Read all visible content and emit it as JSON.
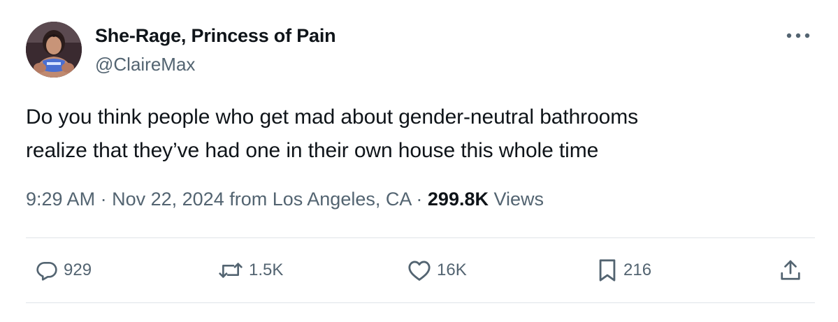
{
  "author": {
    "display_name": "She-Rage, Princess of Pain",
    "handle": "@ClaireMax",
    "avatar_icon": "profile-photo"
  },
  "tweet": {
    "text": "Do you think people who get mad about gender-neutral bathrooms\nrealize that they’ve had one in their own house this whole time",
    "time": "9:29 AM",
    "separator": "·",
    "date": "Nov 22, 2024",
    "location": "from Los Angeles, CA",
    "views_count": "299.8K",
    "views_label": "Views"
  },
  "actions": {
    "reply": {
      "icon": "reply-icon",
      "count": "929"
    },
    "repost": {
      "icon": "repost-icon",
      "count": "1.5K"
    },
    "like": {
      "icon": "heart-icon",
      "count": "16K"
    },
    "bookmark": {
      "icon": "bookmark-icon",
      "count": "216"
    },
    "share": {
      "icon": "share-icon"
    }
  },
  "menu": {
    "icon": "more-icon"
  },
  "colors": {
    "text_primary": "#0f1419",
    "text_secondary": "#536471",
    "divider": "#dfe4e8",
    "background": "#ffffff"
  }
}
